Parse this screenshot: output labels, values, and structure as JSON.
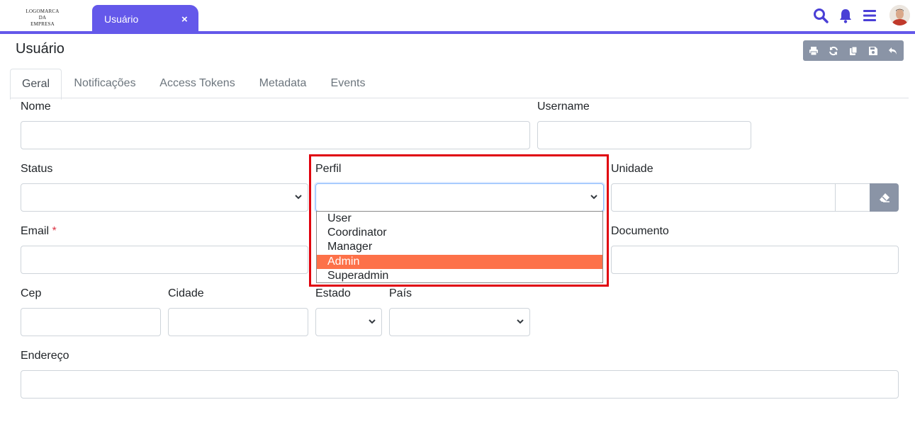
{
  "header": {
    "logo_lines": [
      "LOGOMARCA",
      "DA",
      "EMPRESA"
    ],
    "open_tab": "Usuário",
    "close_symbol": "×",
    "icons": [
      "search-icon",
      "bell-icon",
      "menu-icon",
      "avatar"
    ],
    "accent_color": "#6458ea"
  },
  "page": {
    "title": "Usuário",
    "toolbar_icons": [
      "print-icon",
      "refresh-icon",
      "copy-icon",
      "save-icon",
      "undo-icon"
    ]
  },
  "tabs": [
    "Geral",
    "Notificações",
    "Access Tokens",
    "Metadata",
    "Events"
  ],
  "active_tab": "Geral",
  "form": {
    "nome": {
      "label": "Nome",
      "value": ""
    },
    "username": {
      "label": "Username",
      "value": ""
    },
    "status": {
      "label": "Status",
      "value": ""
    },
    "perfil": {
      "label": "Perfil",
      "value": ""
    },
    "unidade": {
      "label": "Unidade",
      "value": ""
    },
    "email": {
      "label": "Email",
      "required_mark": "*",
      "value": ""
    },
    "documento": {
      "label": "Documento",
      "value": ""
    },
    "cep": {
      "label": "Cep",
      "value": ""
    },
    "cidade": {
      "label": "Cidade",
      "value": ""
    },
    "estado": {
      "label": "Estado",
      "value": ""
    },
    "pais": {
      "label": "País",
      "value": ""
    },
    "endereco": {
      "label": "Endereço",
      "value": ""
    }
  },
  "perfil_dropdown": {
    "options": [
      "User",
      "Coordinator",
      "Manager",
      "Admin",
      "Superadmin"
    ],
    "highlighted": "Admin",
    "highlight_color": "#fd7149",
    "annotation_color": "#e0000d"
  }
}
